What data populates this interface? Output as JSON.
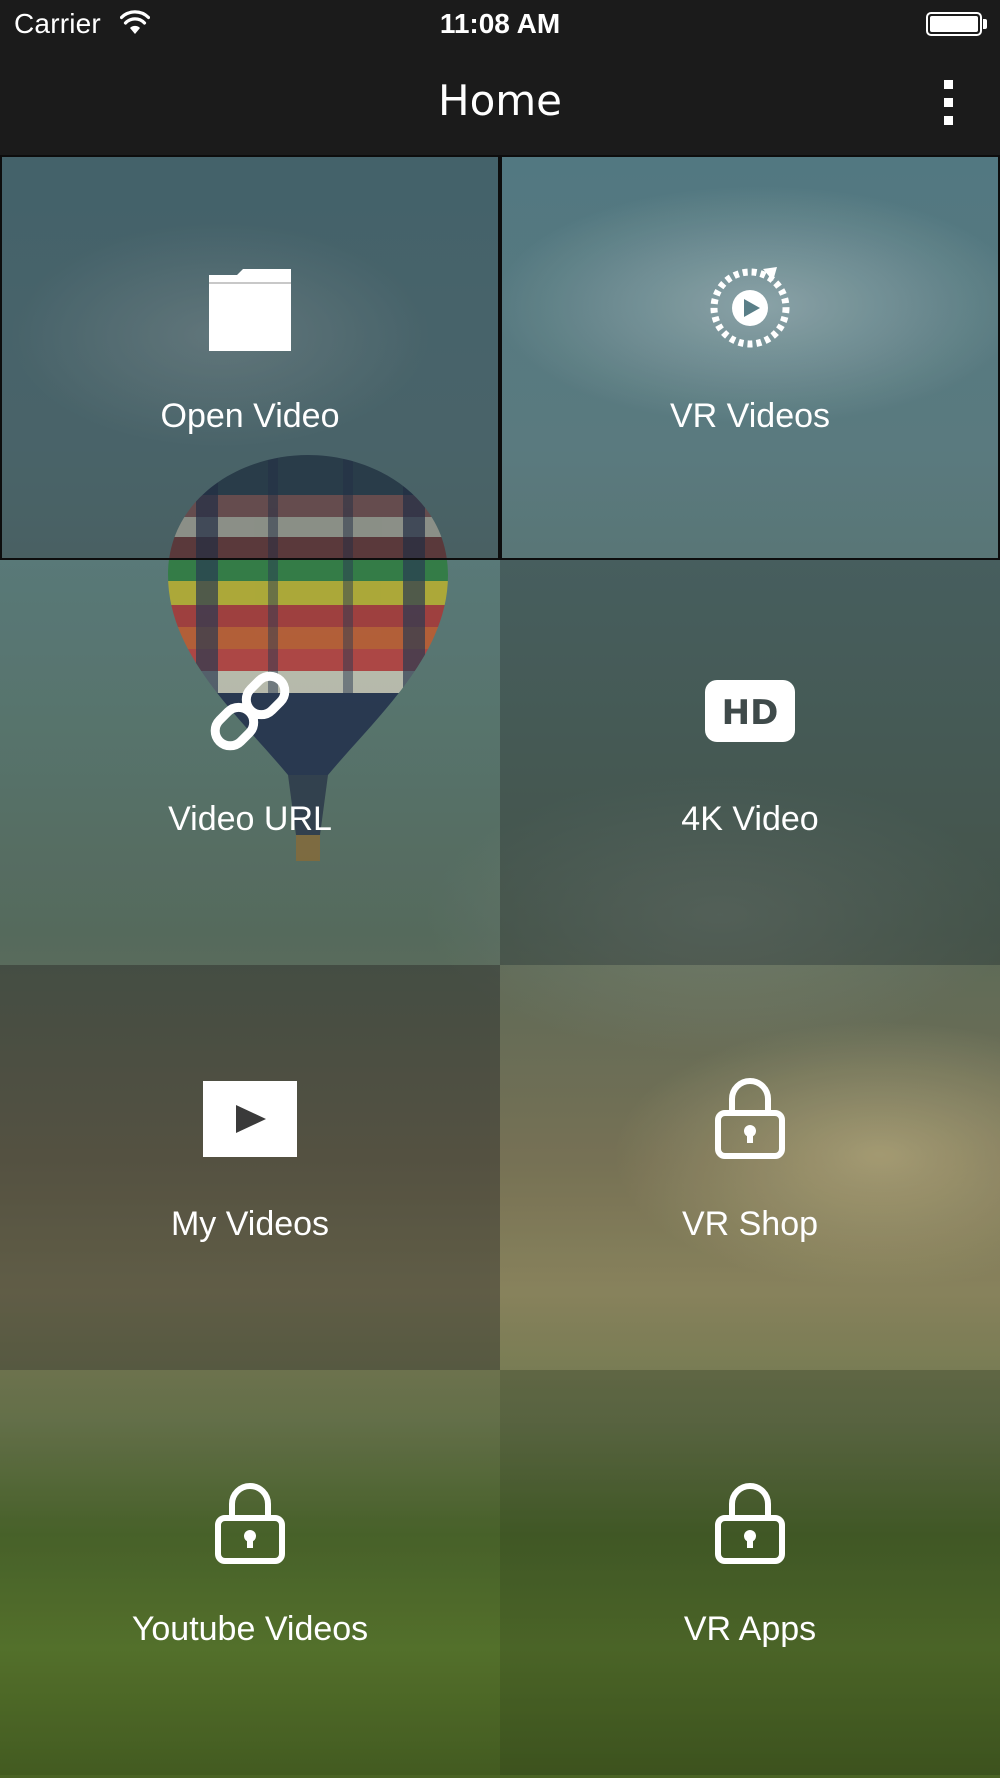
{
  "status_bar": {
    "carrier": "Carrier",
    "time": "11:08 AM",
    "battery_level": 1.0
  },
  "nav": {
    "title": "Home",
    "more_icon": "more-vertical-icon"
  },
  "tiles": [
    {
      "label": "Open Video",
      "icon": "folder-icon"
    },
    {
      "label": "VR Videos",
      "icon": "vr-play-icon"
    },
    {
      "label": "Video URL",
      "icon": "link-icon"
    },
    {
      "label": "4K Video",
      "icon": "hd-icon"
    },
    {
      "label": "My Videos",
      "icon": "play-box-icon"
    },
    {
      "label": "VR Shop",
      "icon": "lock-icon"
    },
    {
      "label": "Youtube Videos",
      "icon": "lock-icon"
    },
    {
      "label": "VR Apps",
      "icon": "lock-icon"
    }
  ]
}
